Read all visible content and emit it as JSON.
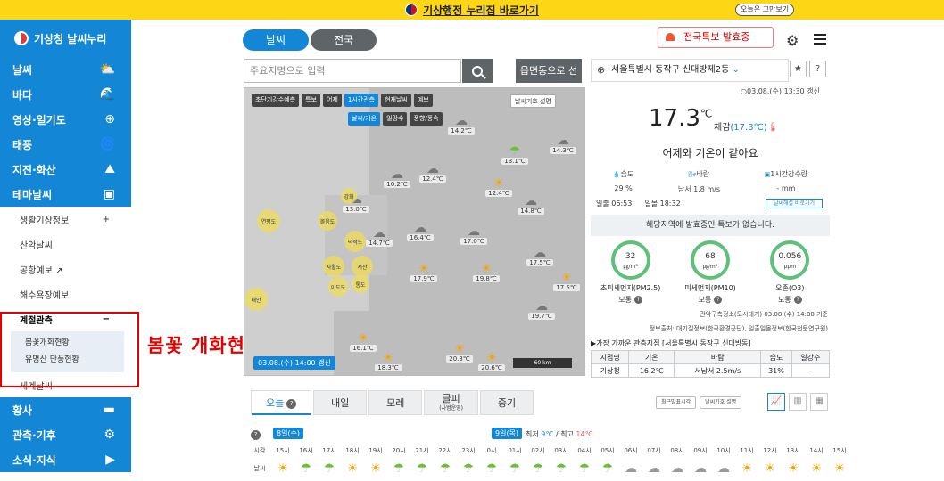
{
  "topbar": {
    "nuri_link": "기상행정 누리집 바로가기",
    "close_today": "오늘은 그만보기"
  },
  "sidebar": {
    "logo": "기상청 날씨누리",
    "menu_top": [
      {
        "label": "날씨",
        "icon": "⛅"
      },
      {
        "label": "바다",
        "icon": "🌊"
      },
      {
        "label": "영상·일기도",
        "icon": "⊕"
      },
      {
        "label": "태풍",
        "icon": "🌀"
      },
      {
        "label": "지진·화산",
        "icon": "⛰"
      },
      {
        "label": "테마날씨",
        "icon": "▣"
      }
    ],
    "sub": [
      {
        "label": "생활기상정보",
        "mark": "+"
      },
      {
        "label": "산악날씨",
        "mark": ""
      },
      {
        "label": "공항예보 ↗",
        "mark": ""
      },
      {
        "label": "해수욕장예보",
        "mark": ""
      },
      {
        "label": "계절관측",
        "mark": "−"
      }
    ],
    "sub2": [
      "봄꽃개화현황",
      "유명산 단풍현황"
    ],
    "sub_last": "세계날씨",
    "menu_bottom": [
      {
        "label": "황사",
        "icon": "▬"
      },
      {
        "label": "관측·기후",
        "icon": "⚙"
      },
      {
        "label": "소식·지식",
        "icon": "▶"
      }
    ]
  },
  "annotation": "봄꽃 개화현황 클릭",
  "tabs": {
    "weather": "날씨",
    "national": "전국"
  },
  "search": {
    "placeholder": "주요지명으로 입력",
    "area_button": "읍면동으로 선택"
  },
  "map": {
    "buttons_row1": [
      "초단기강수예측",
      "특보",
      "어제",
      "1시간관측",
      "현재날씨",
      "예보"
    ],
    "buttons_row2": [
      "날씨/기온",
      "일강수",
      "풍향/풍속"
    ],
    "legend_button": "날씨기호 설명",
    "time": "03.08.(수) 14:00 갱신",
    "scale": "60 km",
    "stations": [
      {
        "v": "14.2℃",
        "i": "☁"
      },
      {
        "v": "14.3℃",
        "i": "☁"
      },
      {
        "v": "13.1℃",
        "i": "☂"
      },
      {
        "v": "10.2℃",
        "i": "☁"
      },
      {
        "v": "12.4℃",
        "i": "☁"
      },
      {
        "v": "12.4℃",
        "i": "☀"
      },
      {
        "v": "14.8℃",
        "i": "☁"
      },
      {
        "v": "13.0℃",
        "i": "☁"
      },
      {
        "v": "14.7℃",
        "i": "☁"
      },
      {
        "v": "16.4℃",
        "i": "☁"
      },
      {
        "v": "17.0℃",
        "i": "☁"
      },
      {
        "v": "17.5℃",
        "i": "☁"
      },
      {
        "v": "17.9℃",
        "i": "☀"
      },
      {
        "v": "19.8℃",
        "i": "☀"
      },
      {
        "v": "17.5℃",
        "i": "☀"
      },
      {
        "v": "19.7℃",
        "i": "☁"
      },
      {
        "v": "16.1℃",
        "i": "☀"
      },
      {
        "v": "18.3℃",
        "i": "☀"
      },
      {
        "v": "20.3℃",
        "i": "☀"
      },
      {
        "v": "20.6℃",
        "i": "☀"
      }
    ],
    "dust": [
      "연평도",
      "볼음도",
      "강화",
      "덕적도",
      "자월도",
      "서산",
      "이도도",
      "통도",
      "태안"
    ]
  },
  "alert_button": "전국특보 발효중",
  "location": "서울특별시 동작구 신대방제2동",
  "updated": "03.08.(수) 13:30 갱신",
  "current": {
    "temp": "17.3",
    "unit": "℃",
    "feel_label": "체감",
    "feel_value": "(17.3℃)",
    "compare": "어제와 기온이 같아요"
  },
  "stats": [
    {
      "label": "습도",
      "value": "29 %"
    },
    {
      "label": "바람",
      "value": "남서 1.8 m/s"
    },
    {
      "label": "1시간강수량",
      "value": "- mm"
    }
  ],
  "sun": {
    "rise_label": "일출",
    "rise": "06:53",
    "set_label": "일몰",
    "set": "18:32"
  },
  "comment_button": "날씨해설 바로가기",
  "no_alert": "해당지역에 발효중인 특보가 없습니다.",
  "dust_panel": [
    {
      "value": "32",
      "unit": "㎍/m³",
      "name": "초미세먼지(PM2.5)",
      "grade": "보통"
    },
    {
      "value": "68",
      "unit": "㎍/m³",
      "name": "미세먼지(PM10)",
      "grade": "보통"
    },
    {
      "value": "0.056",
      "unit": "ppm",
      "name": "오존(O3)",
      "grade": "보통"
    }
  ],
  "source1": "관악구측정소(도시대기) 03.08.(수) 14:00 기준",
  "source2": "정보출처: 대기질정보(한국환경공단), 일출일몰정보(한국천문연구원)",
  "nearest": "▶가장 가까운 관측지점 [서울특별시 동작구 신대방동]",
  "obs_table": {
    "headers": [
      "지점명",
      "기온",
      "바람",
      "습도",
      "일강수"
    ],
    "row": [
      "기상청",
      "16.2℃",
      "서남서 2.5m/s",
      "31%",
      "-"
    ]
  },
  "forecast_tabs": [
    {
      "label": "오늘",
      "sub": ""
    },
    {
      "label": "내일",
      "sub": ""
    },
    {
      "label": "모레",
      "sub": ""
    },
    {
      "label": "글피",
      "sub": "(사범운영)"
    },
    {
      "label": "중기",
      "sub": ""
    }
  ],
  "forecast_buttons": [
    "최근발표시각",
    "날씨기호 설명"
  ],
  "day1": "8일(수)",
  "day2": "9일(목)",
  "minmax": {
    "min_label": "최저",
    "min": "9℃",
    "max_label": "최고",
    "max": "14℃"
  },
  "hours_label": "시각",
  "weather_label": "날씨",
  "hours": [
    "15시",
    "16시",
    "17시",
    "18시",
    "19시",
    "20시",
    "21시",
    "22시",
    "23시",
    "0시",
    "01시",
    "02시",
    "03시",
    "04시",
    "05시",
    "06시",
    "07시",
    "08시",
    "09시",
    "10시",
    "11시",
    "12시",
    "13시",
    "14시",
    "15시"
  ],
  "weather_icons": [
    "☀",
    "☂",
    "☂",
    "☀",
    "☀",
    "☂",
    "☂",
    "☂",
    "☂",
    "☂",
    "☂",
    "☂",
    "☂",
    "☂",
    "☂",
    "☁",
    "☁",
    "☁",
    "☁",
    "☁",
    "☀",
    "☀",
    "☀",
    "☀",
    "☀"
  ]
}
